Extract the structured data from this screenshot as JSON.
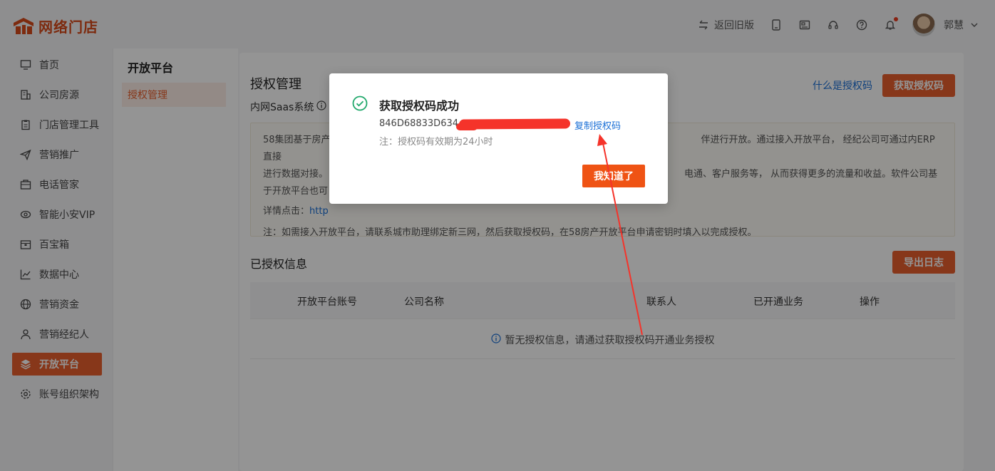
{
  "header": {
    "logo_text": "网络门店",
    "back_label": "返回旧版",
    "user_name": "郭慧",
    "colors": {
      "brand": "#d84a1b",
      "accent": "#e8602d"
    }
  },
  "sidebar": {
    "items": [
      {
        "label": "首页",
        "icon": "monitor-icon"
      },
      {
        "label": "公司房源",
        "icon": "building-icon"
      },
      {
        "label": "门店管理工具",
        "icon": "clipboard-icon"
      },
      {
        "label": "营销推广",
        "icon": "paper-plane-icon"
      },
      {
        "label": "电话管家",
        "icon": "phone-box-icon"
      },
      {
        "label": "智能小安VIP",
        "icon": "eye-icon"
      },
      {
        "label": "百宝箱",
        "icon": "treasure-box-icon"
      },
      {
        "label": "数据中心",
        "icon": "chart-icon"
      },
      {
        "label": "营销资金",
        "icon": "globe-icon"
      },
      {
        "label": "营销经纪人",
        "icon": "person-icon"
      },
      {
        "label": "开放平台",
        "icon": "layers-icon",
        "active": true
      },
      {
        "label": "账号组织架构",
        "icon": "gear-icon"
      }
    ]
  },
  "subnav": {
    "title": "开放平台",
    "items": [
      {
        "label": "授权管理",
        "active": true
      }
    ]
  },
  "main": {
    "title": "授权管理",
    "what_link": "什么是授权码",
    "get_code_button": "获取授权码",
    "sub_line": "内网Saas系统",
    "info": {
      "line1": "58集团基于房产",
      "line1_right": "伴进行开放。通过接入开放平台， 经纪公司可通过内ERP直接",
      "line2": "进行数据对接。",
      "line2_right": "电通、客户服务等， 从而获得更多的流量和收益。软件公司基",
      "line3": "于开放平台也可",
      "detail_prefix": "详情点击：",
      "detail_link": "http",
      "note": "注：如需接入开放平台，请联系城市助理绑定新三网，然后获取授权码，在58房产开放平台申请密钥时填入以完成授权。"
    },
    "authorized_title": "已授权信息",
    "export_button": "导出日志",
    "table": {
      "columns": [
        "开放平台账号",
        "公司名称",
        "联系人",
        "已开通业务",
        "操作"
      ],
      "empty_text": "暂无授权信息，请通过获取授权码开通业务授权"
    }
  },
  "modal": {
    "title": "获取授权码成功",
    "code_visible": "846D68833D634",
    "copy_label": "复制授权码",
    "note": "注：授权码有效期为24小时",
    "ok_button": "我知道了",
    "colors": {
      "success": "#20a86b",
      "redact": "#f5332a",
      "button": "#ef5314"
    }
  }
}
